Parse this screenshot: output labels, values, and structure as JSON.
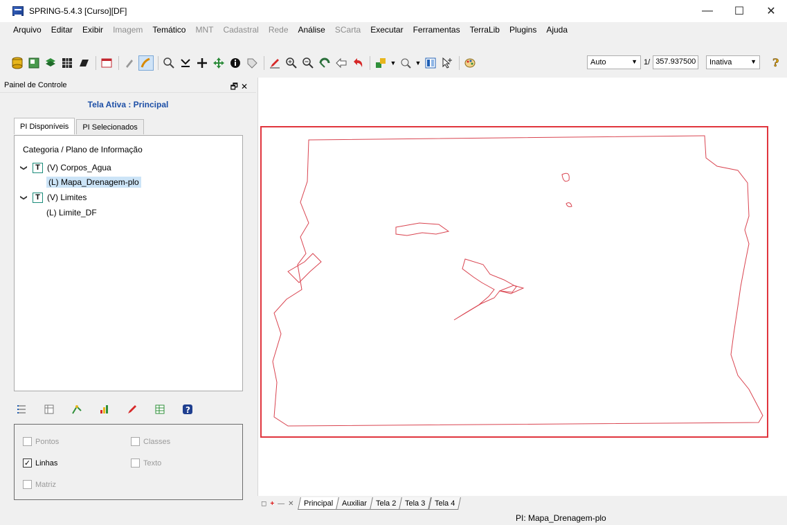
{
  "window": {
    "title": "SPRING-5.4.3 [Curso][DF]",
    "minimize": "—",
    "maximize": "☐",
    "close": "✕"
  },
  "menu": {
    "items": [
      {
        "label": "Arquivo",
        "enabled": true
      },
      {
        "label": "Editar",
        "enabled": true
      },
      {
        "label": "Exibir",
        "enabled": true
      },
      {
        "label": "Imagem",
        "enabled": false
      },
      {
        "label": "Temático",
        "enabled": true
      },
      {
        "label": "MNT",
        "enabled": false
      },
      {
        "label": "Cadastral",
        "enabled": false
      },
      {
        "label": "Rede",
        "enabled": false
      },
      {
        "label": "Análise",
        "enabled": true
      },
      {
        "label": "SCarta",
        "enabled": false
      },
      {
        "label": "Executar",
        "enabled": true
      },
      {
        "label": "Ferramentas",
        "enabled": true
      },
      {
        "label": "TerraLib",
        "enabled": true
      },
      {
        "label": "Plugins",
        "enabled": true
      },
      {
        "label": "Ajuda",
        "enabled": true
      }
    ]
  },
  "toolbar": {
    "zoom_mode": "Auto",
    "scale_prefix": "1/",
    "scale_value": "357.937500",
    "state": "Inativa",
    "colors": {
      "yellow": "#e8b61c",
      "green": "#2f8f3a",
      "red": "#d62828",
      "blue": "#1f5fb5"
    }
  },
  "panel": {
    "title": "Painel de Controle",
    "active_screen": "Tela Ativa : Principal",
    "tabs": [
      {
        "label": "PI Disponíveis",
        "active": true
      },
      {
        "label": "PI Selecionados",
        "active": false
      }
    ],
    "tree_header": "Categoria / Plano de Informação",
    "tree": [
      {
        "label": "(V) Corpos_Agua",
        "type": "category"
      },
      {
        "label": "(L) Mapa_Drenagem-plo",
        "type": "plan",
        "selected": true
      },
      {
        "label": "(V) Limites",
        "type": "category"
      },
      {
        "label": "(L) Limite_DF",
        "type": "plan",
        "selected": false
      }
    ],
    "category_badge": "T",
    "checkboxes": [
      {
        "label": "Pontos",
        "checked": false,
        "enabled": false
      },
      {
        "label": "Classes",
        "checked": false,
        "enabled": false
      },
      {
        "label": "Linhas",
        "checked": true,
        "enabled": true
      },
      {
        "label": "Texto",
        "checked": false,
        "enabled": false
      },
      {
        "label": "Matriz",
        "checked": false,
        "enabled": false
      }
    ]
  },
  "map": {
    "frame_color": "#e0343d",
    "line_color": "#d9434f"
  },
  "bottom_tabs": [
    "Principal",
    "Auxiliar",
    "Tela 2",
    "Tela 3",
    "Tela 4"
  ],
  "status": {
    "text": "PI: Mapa_Drenagem-plo"
  }
}
